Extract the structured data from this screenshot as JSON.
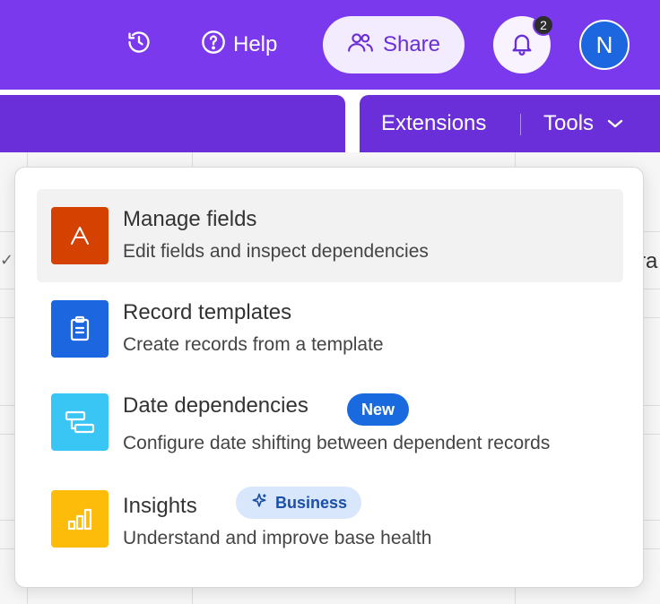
{
  "header": {
    "help_label": "Help",
    "share_label": "Share",
    "notification_count": "2",
    "avatar_initial": "N",
    "icons": [
      "history-icon",
      "help-icon",
      "share-people-icon",
      "bell-icon"
    ],
    "colors": {
      "header_bg": "#7b39ed",
      "subbar_bg": "#6a2fd9",
      "avatar_bg": "#1c66e0"
    }
  },
  "subbar": {
    "extensions_label": "Extensions",
    "tools_label": "Tools"
  },
  "background": {
    "peek_right_text": "ra",
    "peek_left_text": "✓"
  },
  "menu": {
    "items": [
      {
        "title": "Manage fields",
        "desc": "Edit fields and inspect dependencies",
        "icon": "text-field-icon",
        "icon_glyph": "A",
        "color": "#d54100"
      },
      {
        "title": "Record templates",
        "desc": "Create records from a template",
        "icon": "clipboard-icon",
        "color": "#1c66e0"
      },
      {
        "title": "Date dependencies",
        "desc": "Configure date shifting between dependent records",
        "icon": "dependency-icon",
        "color": "#39c6f5",
        "badge": "New"
      },
      {
        "title": "Insights",
        "desc": "Understand and improve base health",
        "icon": "bar-chart-icon",
        "color": "#fdbb0a",
        "badge": "Business",
        "badge_icon": "sparkle-icon"
      }
    ]
  }
}
